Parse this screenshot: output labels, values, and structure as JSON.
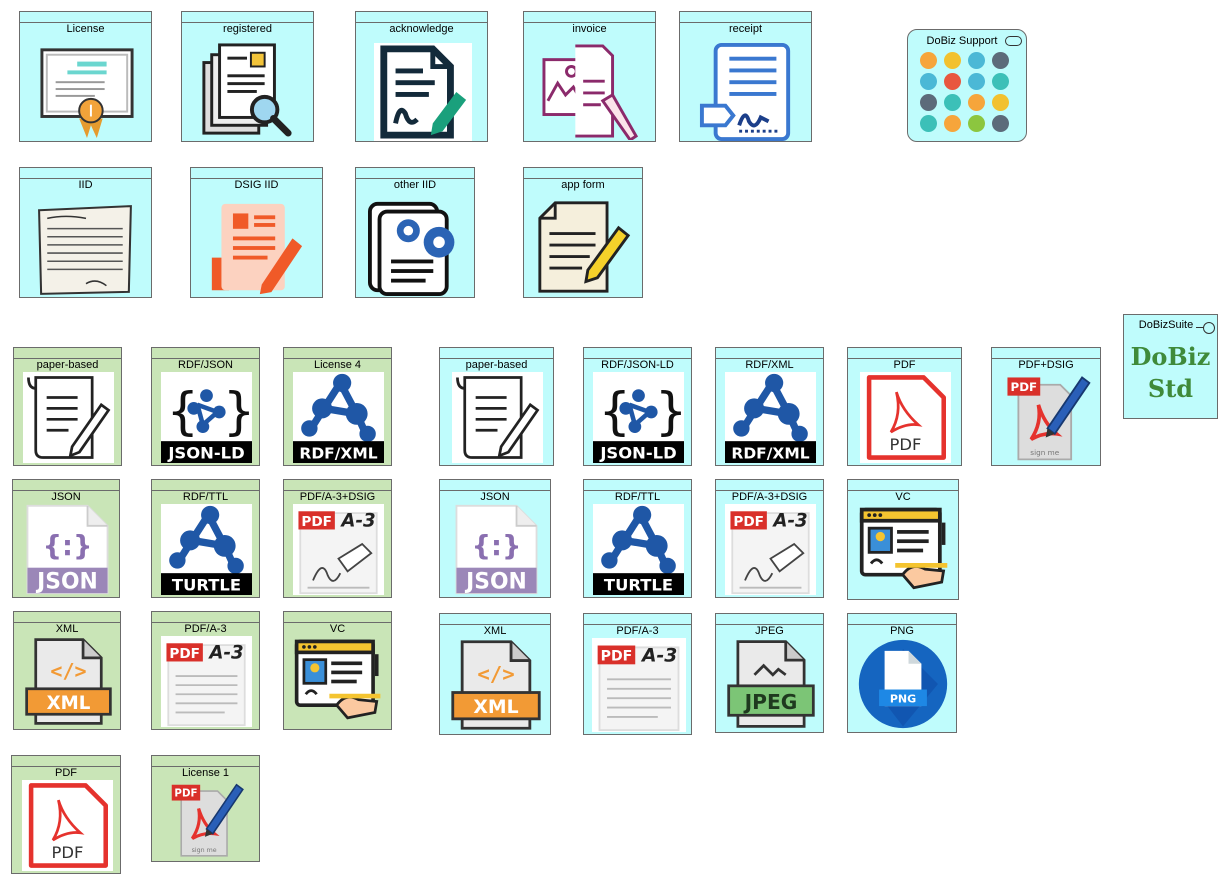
{
  "top_row": [
    {
      "label": "License",
      "icon": "certificate-icon"
    },
    {
      "label": "registered",
      "icon": "document-search-icon"
    },
    {
      "label": "acknowledge",
      "icon": "document-sign-icon"
    },
    {
      "label": "invoice",
      "icon": "invoice-documents-icon"
    },
    {
      "label": "receipt",
      "icon": "receipt-signature-icon"
    }
  ],
  "second_row": [
    {
      "label": "IID",
      "icon": "paper-sheet-icon"
    },
    {
      "label": "DSIG IID",
      "icon": "document-pen-icon"
    },
    {
      "label": "other IID",
      "icon": "document-gears-icon"
    },
    {
      "label": "app form",
      "icon": "form-pencil-icon"
    }
  ],
  "support": {
    "label": "DoBiz Support",
    "icon": "app-grid-icon"
  },
  "suite": {
    "label": "DoBizSuite",
    "brand_line1": "DoBiz",
    "brand_line2": "Std"
  },
  "green_group": [
    {
      "label": "paper-based",
      "icon": "scroll-pencil-icon"
    },
    {
      "label": "RDF/JSON",
      "icon": "json-ld-icon",
      "caption": "JSON-LD"
    },
    {
      "label": "License 4",
      "icon": "rdf-xml-icon",
      "caption": "RDF/XML"
    },
    {
      "label": "JSON",
      "icon": "json-file-icon",
      "caption": "JSON"
    },
    {
      "label": "RDF/TTL",
      "icon": "turtle-icon",
      "caption": "TURTLE"
    },
    {
      "label": "PDF/A-3+DSIG",
      "icon": "pdfa3-sign-icon",
      "caption": "PDF",
      "caption2": "A-3"
    },
    {
      "label": "XML",
      "icon": "xml-file-icon",
      "caption": "XML"
    },
    {
      "label": "PDF/A-3",
      "icon": "pdfa3-icon",
      "caption": "PDF",
      "caption2": "A-3"
    },
    {
      "label": "VC",
      "icon": "verifiable-credential-icon"
    },
    {
      "label": "PDF",
      "icon": "pdf-file-icon",
      "caption": "PDF"
    },
    {
      "label": "License 1",
      "icon": "pdf-sign-icon",
      "caption": "PDF",
      "caption2": "sign me"
    }
  ],
  "cyan_group": [
    {
      "label": "paper-based",
      "icon": "scroll-pencil-icon"
    },
    {
      "label": "RDF/JSON-LD",
      "icon": "json-ld-icon",
      "caption": "JSON-LD"
    },
    {
      "label": "RDF/XML",
      "icon": "rdf-xml-icon",
      "caption": "RDF/XML"
    },
    {
      "label": "PDF",
      "icon": "pdf-file-icon",
      "caption": "PDF"
    },
    {
      "label": "PDF+DSIG",
      "icon": "pdf-sign-icon",
      "caption": "PDF",
      "caption2": "sign me"
    },
    {
      "label": "JSON",
      "icon": "json-file-icon",
      "caption": "JSON"
    },
    {
      "label": "RDF/TTL",
      "icon": "turtle-icon",
      "caption": "TURTLE"
    },
    {
      "label": "PDF/A-3+DSIG",
      "icon": "pdfa3-sign-icon",
      "caption": "PDF",
      "caption2": "A-3"
    },
    {
      "label": "VC",
      "icon": "verifiable-credential-icon"
    },
    {
      "label": "XML",
      "icon": "xml-file-icon",
      "caption": "XML"
    },
    {
      "label": "PDF/A-3",
      "icon": "pdfa3-icon",
      "caption": "PDF",
      "caption2": "A-3"
    },
    {
      "label": "JPEG",
      "icon": "jpeg-file-icon",
      "caption": "JPEG"
    },
    {
      "label": "PNG",
      "icon": "png-file-icon",
      "caption": "PNG"
    }
  ],
  "colors": {
    "cyan_fill": "#bffcfc",
    "green_fill": "#c9e5b7",
    "border": "#6b6b6b",
    "brand_green": "#3f8a3a"
  }
}
